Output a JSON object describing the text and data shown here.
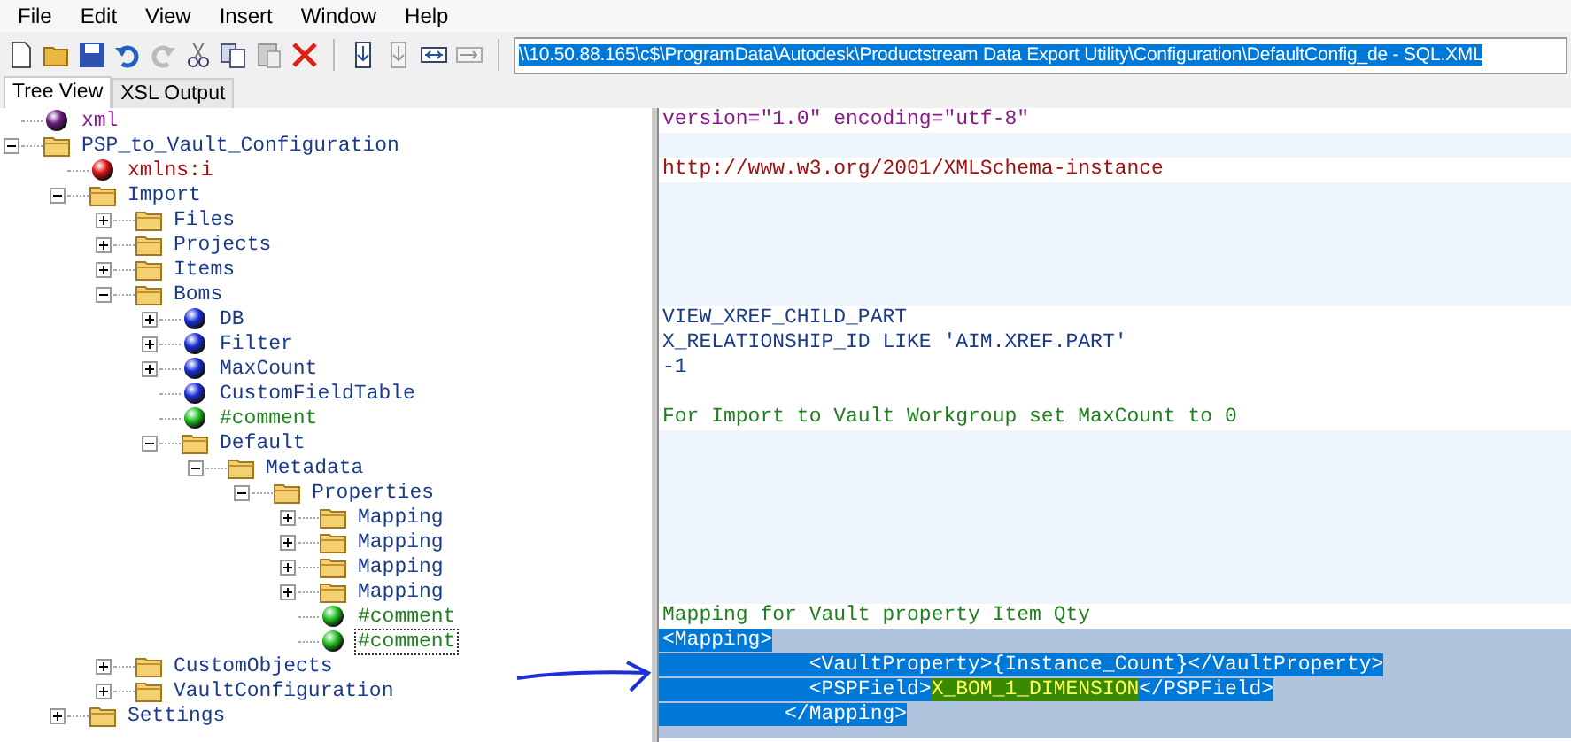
{
  "menu": [
    "File",
    "Edit",
    "View",
    "Insert",
    "Window",
    "Help"
  ],
  "address": {
    "value": "\\\\10.50.88.165\\c$\\ProgramData\\Autodesk\\Productstream Data Export Utility\\Configuration\\DefaultConfig_de - SQL.XML",
    "selected": true
  },
  "tabs": [
    {
      "label": "Tree View",
      "selected": true
    },
    {
      "label": "XSL Output",
      "selected": false
    }
  ],
  "tree": [
    {
      "label": "xml",
      "kind": "declaration",
      "selected": false
    },
    {
      "label": "PSP_to_Vault_Configuration",
      "kind": "folder",
      "expanded": true,
      "selected": false,
      "children": [
        {
          "label": "xmlns:i",
          "kind": "attribute",
          "selected": false
        },
        {
          "label": "Import",
          "kind": "folder",
          "expanded": true,
          "selected": false,
          "children": [
            {
              "label": "Files",
              "kind": "folder",
              "expanded": false,
              "selected": false
            },
            {
              "label": "Projects",
              "kind": "folder",
              "expanded": false,
              "selected": false
            },
            {
              "label": "Items",
              "kind": "folder",
              "expanded": false,
              "selected": false
            },
            {
              "label": "Boms",
              "kind": "folder",
              "expanded": true,
              "selected": false,
              "children": [
                {
                  "label": "DB",
                  "kind": "element",
                  "expanded": false,
                  "selected": false
                },
                {
                  "label": "Filter",
                  "kind": "element",
                  "expanded": false,
                  "selected": false
                },
                {
                  "label": "MaxCount",
                  "kind": "element",
                  "expanded": false,
                  "selected": false
                },
                {
                  "label": "CustomFieldTable",
                  "kind": "element",
                  "selected": false
                },
                {
                  "label": "#comment",
                  "kind": "comment",
                  "selected": false
                },
                {
                  "label": "Default",
                  "kind": "folder",
                  "expanded": true,
                  "selected": false,
                  "children": [
                    {
                      "label": "Metadata",
                      "kind": "folder",
                      "expanded": true,
                      "selected": false,
                      "children": [
                        {
                          "label": "Properties",
                          "kind": "folder",
                          "expanded": true,
                          "selected": false,
                          "children": [
                            {
                              "label": "Mapping",
                              "kind": "folder",
                              "expanded": false,
                              "selected": false
                            },
                            {
                              "label": "Mapping",
                              "kind": "folder",
                              "expanded": false,
                              "selected": false
                            },
                            {
                              "label": "Mapping",
                              "kind": "folder",
                              "expanded": false,
                              "selected": false
                            },
                            {
                              "label": "Mapping",
                              "kind": "folder",
                              "expanded": false,
                              "selected": false
                            },
                            {
                              "label": "#comment",
                              "kind": "comment",
                              "selected": false
                            },
                            {
                              "label": "#comment",
                              "kind": "comment",
                              "selected": true
                            }
                          ]
                        }
                      ]
                    }
                  ]
                }
              ]
            },
            {
              "label": "CustomObjects",
              "kind": "folder",
              "expanded": false,
              "selected": false
            },
            {
              "label": "VaultConfiguration",
              "kind": "folder",
              "expanded": false,
              "selected": false
            }
          ]
        },
        {
          "label": "Settings",
          "kind": "folder",
          "expanded": false,
          "selected": false
        }
      ]
    }
  ],
  "values": [
    {
      "kind": "declaration",
      "text": "version=\"1.0\" encoding=\"utf-8\""
    },
    {
      "kind": "blank"
    },
    {
      "kind": "attribute",
      "text": "http://www.w3.org/2001/XMLSchema-instance"
    },
    {
      "kind": "blank"
    },
    {
      "kind": "blank"
    },
    {
      "kind": "blank"
    },
    {
      "kind": "blank"
    },
    {
      "kind": "blank"
    },
    {
      "kind": "text",
      "text": "VIEW_XREF_CHILD_PART"
    },
    {
      "kind": "text",
      "text": "X_RELATIONSHIP_ID LIKE 'AIM.XREF.PART'"
    },
    {
      "kind": "text",
      "text": "-1"
    },
    {
      "kind": "empty"
    },
    {
      "kind": "comment",
      "text": "For Import to Vault Workgroup set MaxCount to 0"
    },
    {
      "kind": "blank"
    },
    {
      "kind": "blank"
    },
    {
      "kind": "blank"
    },
    {
      "kind": "blank"
    },
    {
      "kind": "blank"
    },
    {
      "kind": "blank"
    },
    {
      "kind": "blank"
    },
    {
      "kind": "comment",
      "text": "Mapping for Vault property Item Qty"
    },
    {
      "kind": "markup",
      "selected": true,
      "lines": [
        [
          {
            "text": "<Mapping>"
          }
        ],
        [
          {
            "text": "            <VaultProperty>{Instance_Count}</VaultProperty>"
          }
        ],
        [
          {
            "text": "            <PSPField>"
          },
          {
            "text": "X_BOM_1_DIMENSION",
            "highlight": true
          },
          {
            "text": "</PSPField>"
          }
        ],
        [
          {
            "text": "          </Mapping>"
          }
        ]
      ]
    }
  ]
}
